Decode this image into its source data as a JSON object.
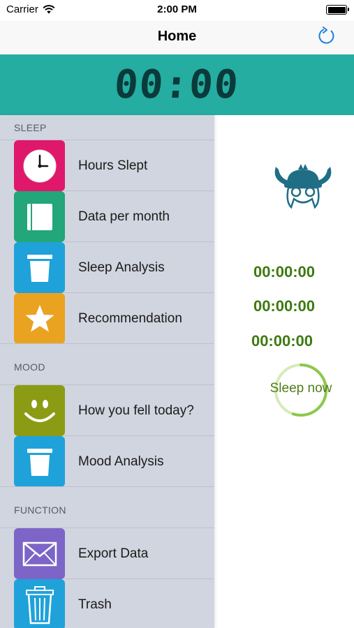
{
  "status": {
    "carrier": "Carrier",
    "time": "2:00 PM"
  },
  "nav": {
    "title": "Home"
  },
  "timer": {
    "display": "00:00"
  },
  "menu": {
    "sections": [
      {
        "header": "SLEEP",
        "items": [
          {
            "label": "Hours Slept",
            "icon": "clock-icon",
            "color": "#e0186c"
          },
          {
            "label": "Data per month",
            "icon": "notebook-icon",
            "color": "#22a67a"
          },
          {
            "label": "Sleep Analysis",
            "icon": "trash-can-icon",
            "color": "#1fa2da"
          },
          {
            "label": "Recommendation",
            "icon": "star-icon",
            "color": "#eaa321"
          }
        ]
      },
      {
        "header": "MOOD",
        "items": [
          {
            "label": "How you fell today?",
            "icon": "smiley-icon",
            "color": "#8c9b14"
          },
          {
            "label": "Mood Analysis",
            "icon": "trash-can-icon",
            "color": "#1fa2da"
          }
        ]
      },
      {
        "header": "FUNCTION",
        "items": [
          {
            "label": "Export Data",
            "icon": "envelope-icon",
            "color": "#7c65c7"
          },
          {
            "label": "Trash",
            "icon": "trash-bin-icon",
            "color": "#1fa2da"
          }
        ]
      }
    ]
  },
  "counters": [
    "00:00:00",
    "00:00:00",
    "00:00:00"
  ],
  "sleep_button": {
    "label": "Sleep now",
    "progress": 0.55
  }
}
